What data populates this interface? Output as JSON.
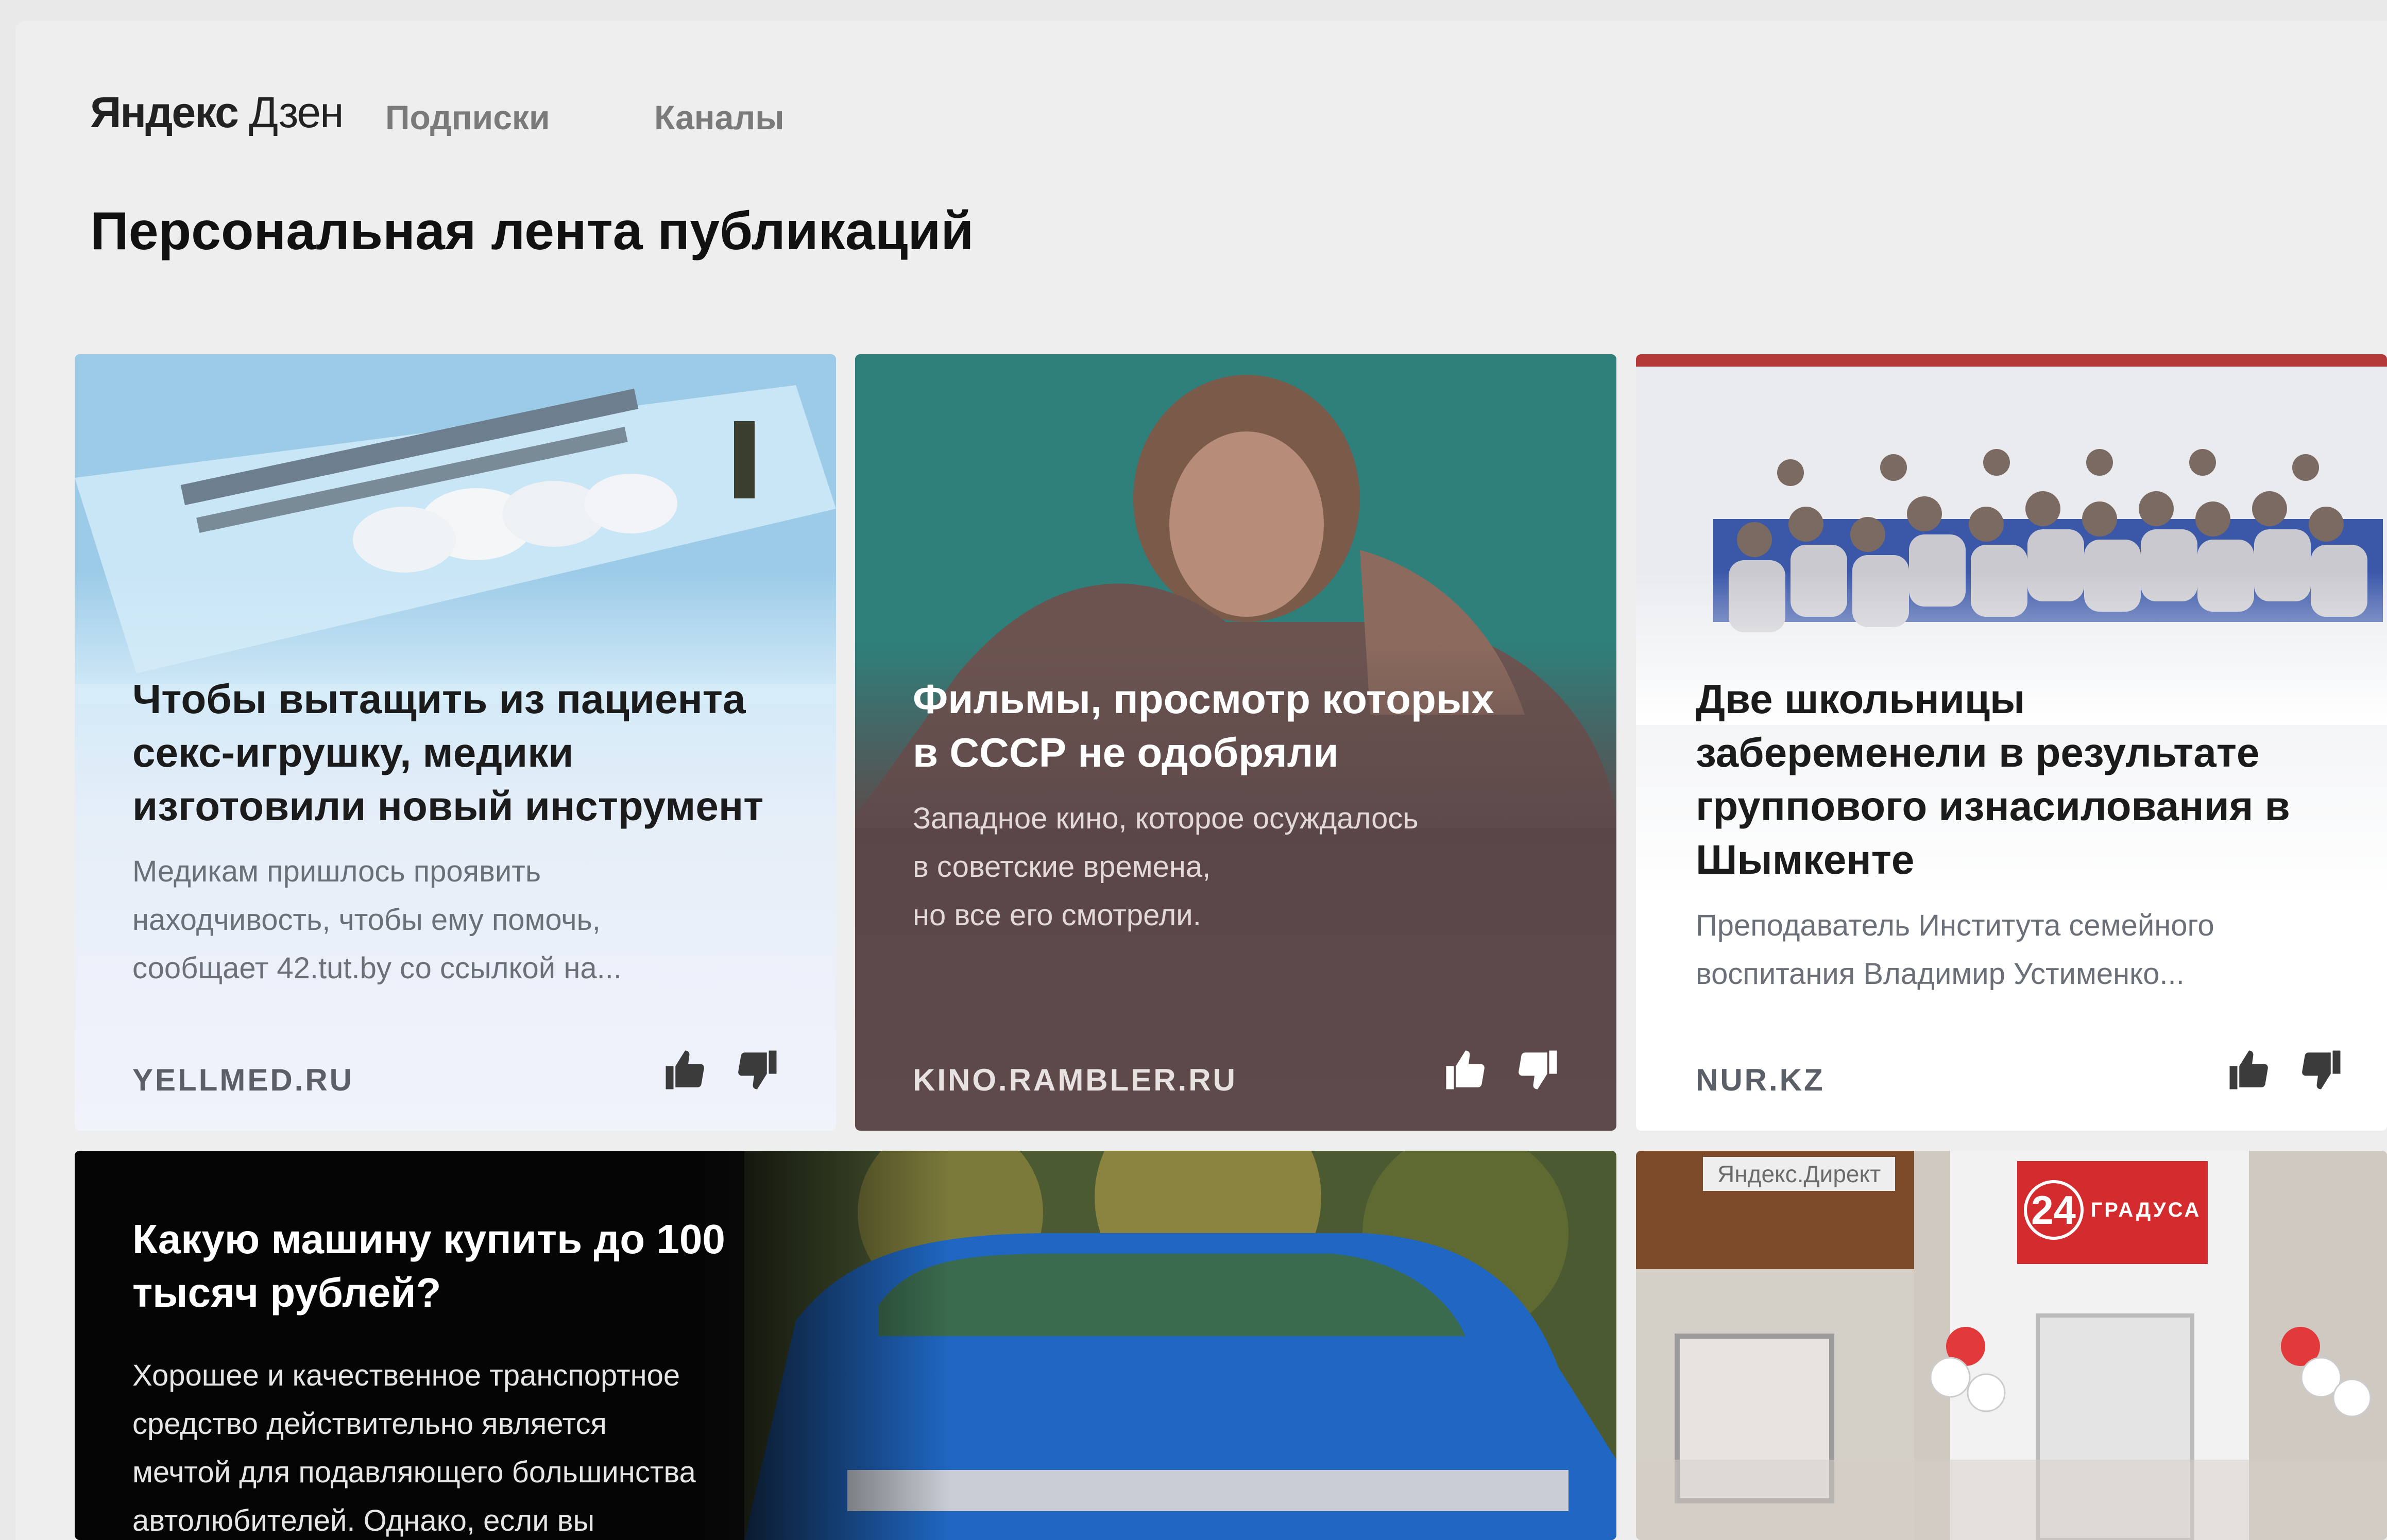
{
  "header": {
    "logo_bold": "Яндекс",
    "logo_light": "Дзен",
    "nav": [
      "Подписки",
      "Каналы"
    ]
  },
  "page_title": "Персональная лента публикаций",
  "cards": [
    {
      "title": [
        "Чтобы вытащить из пациента",
        "секс-игрушку, медики",
        "изготовили новый инструмент"
      ],
      "desc": [
        "Медикам пришлось проявить",
        "находчивость, чтобы ему помочь,",
        "сообщает 42.tut.by со ссылкой на..."
      ],
      "source": "YELLMED.RU"
    },
    {
      "title": [
        "Фильмы, просмотр которых",
        "в СССР не одобряли"
      ],
      "desc": [
        "Западное кино, которое осуждалось",
        "в советские времена,",
        "но все его смотрели."
      ],
      "source": "KINO.RAMBLER.RU"
    },
    {
      "title": [
        "Две школьницы",
        "забеременели в результате",
        "группового изнасилования в",
        "Шымкенте"
      ],
      "desc": [
        "Преподаватель Института семейного",
        "воспитания Владимир Устименко..."
      ],
      "source": "NUR.KZ"
    },
    {
      "title": [
        "Какую машину купить до 100",
        "тысяч рублей?"
      ],
      "desc": [
        "Хорошее и качественное транспортное",
        "средство действительно является",
        "мечтой для подавляющего большинства",
        "автолюбителей. Однако, если вы"
      ]
    },
    {
      "ad_label": "Яндекс.Директ",
      "store_sign": "ГРАДУСА",
      "store_number": "24"
    }
  ],
  "icons": {
    "like": "thumbs-up-icon",
    "dislike": "thumbs-down-icon"
  }
}
